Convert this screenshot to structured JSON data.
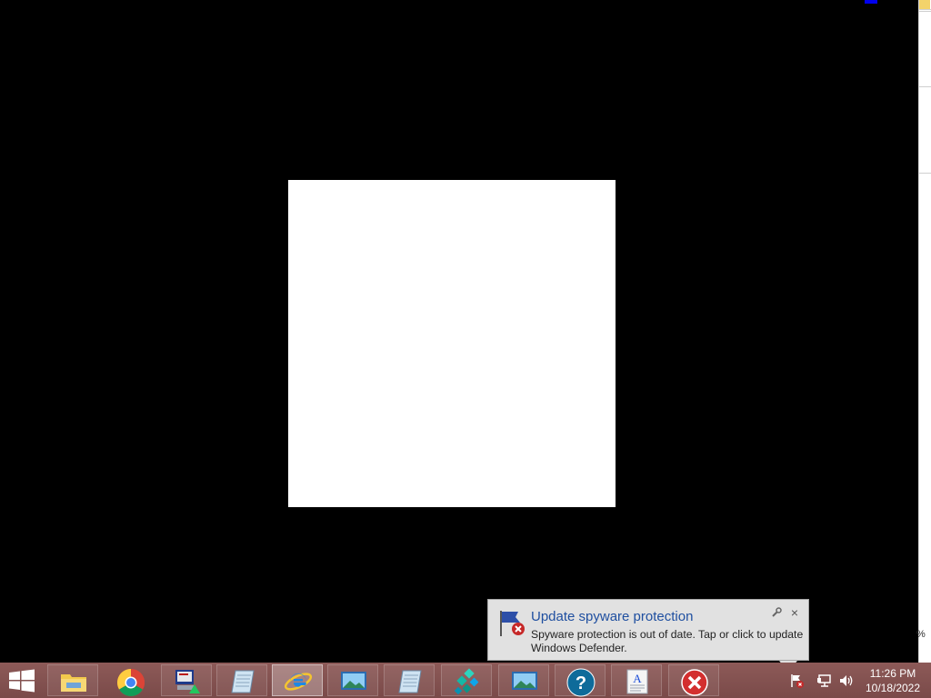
{
  "desktop": {
    "percent_fragment": "%"
  },
  "notification": {
    "title": "Update spyware protection",
    "message": "Spyware protection is out of date. Tap or click to update Windows Defender.",
    "close_label": "×"
  },
  "taskbar": {
    "buttons": [
      {
        "name": "file-explorer",
        "icon": "folder-icon"
      },
      {
        "name": "google-chrome",
        "icon": "chrome-icon"
      },
      {
        "name": "app-monitor",
        "icon": "monitor-app-icon"
      },
      {
        "name": "notepad",
        "icon": "notepad-icon"
      },
      {
        "name": "internet-explorer",
        "icon": "ie-icon",
        "active": true
      },
      {
        "name": "image-viewer",
        "icon": "picture-icon"
      },
      {
        "name": "notepad-2",
        "icon": "notepad-icon"
      },
      {
        "name": "network-tool",
        "icon": "network-icon"
      },
      {
        "name": "image-viewer-2",
        "icon": "picture-icon"
      },
      {
        "name": "help",
        "icon": "help-icon"
      },
      {
        "name": "wordpad",
        "icon": "wordpad-icon"
      },
      {
        "name": "error-app",
        "icon": "error-icon"
      }
    ],
    "tray_icons": [
      "action-center-flag-icon",
      "network-icon",
      "volume-icon"
    ],
    "clock": {
      "time": "11:26 PM",
      "date": "10/18/2022"
    }
  },
  "colors": {
    "taskbar": "#8d5a58",
    "notification_bg": "#e1e1e1",
    "notification_title": "#1f4fa0"
  }
}
